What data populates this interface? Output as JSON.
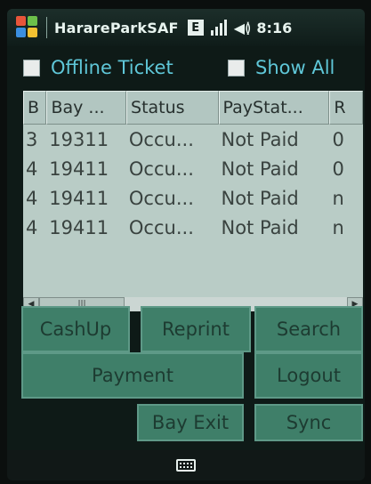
{
  "statusbar": {
    "app_title": "HarareParkSAF",
    "e_label": "E",
    "time": "8:16"
  },
  "options": {
    "offline_ticket": "Offline Ticket",
    "show_all": "Show All"
  },
  "grid": {
    "headers": [
      "B",
      "Bay ...",
      "Status",
      "PayStat...",
      "R"
    ],
    "rows": [
      [
        "3",
        "19311",
        "Occu...",
        "Not Paid",
        "0"
      ],
      [
        "4",
        "19411",
        "Occu...",
        "Not Paid",
        "0"
      ],
      [
        "4",
        "19411",
        "Occu...",
        "Not Paid",
        "n"
      ],
      [
        "4",
        "19411",
        "Occu...",
        "Not Paid",
        "n"
      ]
    ],
    "scroll_thumb": "|||"
  },
  "buttons": {
    "cashup": "CashUp",
    "reprint": "Reprint",
    "search": "Search",
    "payment": "Payment",
    "logout": "Logout",
    "bay_exit": "Bay Exit",
    "sync": "Sync"
  }
}
